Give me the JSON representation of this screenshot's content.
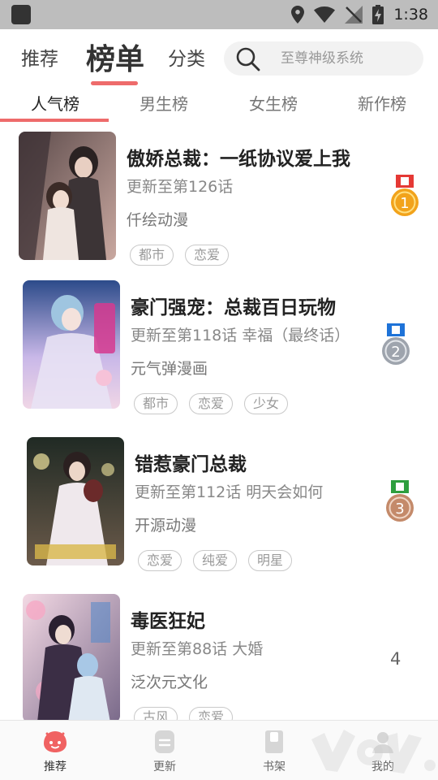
{
  "status_bar": {
    "time": "1:38"
  },
  "top_nav": {
    "tabs": [
      {
        "label": "推荐"
      },
      {
        "label": "榜单"
      },
      {
        "label": "分类"
      }
    ],
    "search_placeholder": "至尊神级系统"
  },
  "rank_tabs": [
    {
      "label": "人气榜"
    },
    {
      "label": "男生榜"
    },
    {
      "label": "女生榜"
    },
    {
      "label": "新作榜"
    }
  ],
  "comics": [
    {
      "title": "傲娇总裁：一纸协议爱上我",
      "update": "更新至第126话",
      "author": "仟绘动漫",
      "tags": [
        "都市",
        "恋爱"
      ],
      "rank": "1",
      "medal_color": "#f2a31b",
      "ribbon_color": "#e53935"
    },
    {
      "title": "豪门强宠：总裁百日玩物",
      "update": "更新至第118话 幸福（最终话）",
      "author": "元气弹漫画",
      "tags": [
        "都市",
        "恋爱",
        "少女"
      ],
      "rank": "2",
      "medal_color": "#9ea4ad",
      "ribbon_color": "#1e73d8"
    },
    {
      "title": "错惹豪门总裁",
      "update": "更新至第112话 明天会如何",
      "author": "开源动漫",
      "tags": [
        "恋爱",
        "纯爱",
        "明星"
      ],
      "rank": "3",
      "medal_color": "#c48a6a",
      "ribbon_color": "#2e9e3e"
    },
    {
      "title": "毒医狂妃",
      "update": "更新至第88话 大婚",
      "author": "泛次元文化",
      "tags": [
        "古风",
        "恋爱"
      ],
      "rank": "4"
    }
  ],
  "bottom_nav": [
    {
      "label": "推荐",
      "icon": "face-icon"
    },
    {
      "label": "更新",
      "icon": "update-icon"
    },
    {
      "label": "书架",
      "icon": "bookshelf-icon"
    },
    {
      "label": "我的",
      "icon": "profile-icon"
    }
  ],
  "colors": {
    "accent": "#ee6b6b",
    "status_bar": "#bdbdbd"
  }
}
